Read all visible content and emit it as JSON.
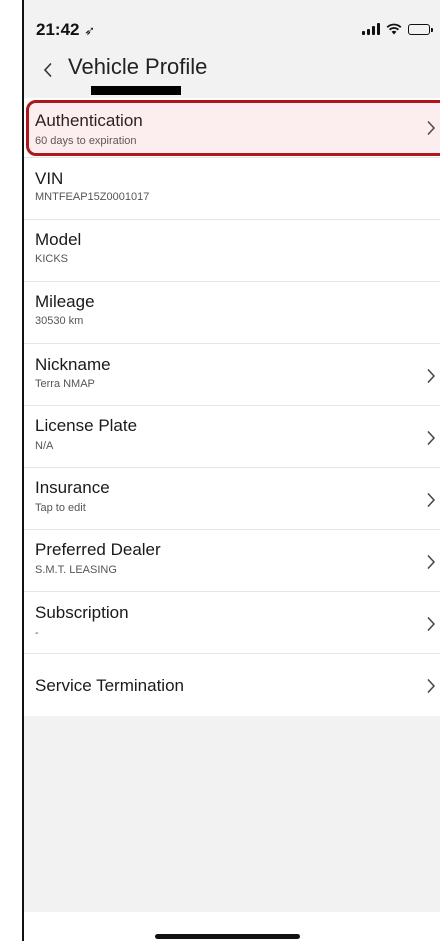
{
  "status_bar": {
    "time": "21:42",
    "location_glyph": "➶",
    "icons": [
      "signal-icon",
      "wifi-icon",
      "battery-icon"
    ]
  },
  "header": {
    "back_icon": "chevron-left-icon",
    "title": "Vehicle Profile"
  },
  "items": [
    {
      "title": "Authentication",
      "subtitle": "60 days to expiration",
      "chevron": true,
      "highlighted": true
    },
    {
      "title": "VIN",
      "subtitle": "MNTFEAP15Z0001017",
      "chevron": false
    },
    {
      "title": "Model",
      "subtitle": "KICKS",
      "chevron": false
    },
    {
      "title": "Mileage",
      "subtitle": "30530 km",
      "chevron": false
    },
    {
      "title": "Nickname",
      "subtitle": "Terra NMAP",
      "chevron": true
    },
    {
      "title": "License Plate",
      "subtitle": "N/A",
      "chevron": true
    },
    {
      "title": "Insurance",
      "subtitle": "Tap to edit",
      "chevron": true
    },
    {
      "title": "Preferred Dealer",
      "subtitle": "S.M.T. LEASING",
      "chevron": true
    },
    {
      "title": "Subscription",
      "subtitle": "-",
      "chevron": true
    },
    {
      "title": "Service Termination",
      "subtitle": "",
      "chevron": true
    }
  ],
  "colors": {
    "highlight_border": "#b0161c",
    "list_background": "#ffffff",
    "page_background": "#f2f2f2"
  }
}
